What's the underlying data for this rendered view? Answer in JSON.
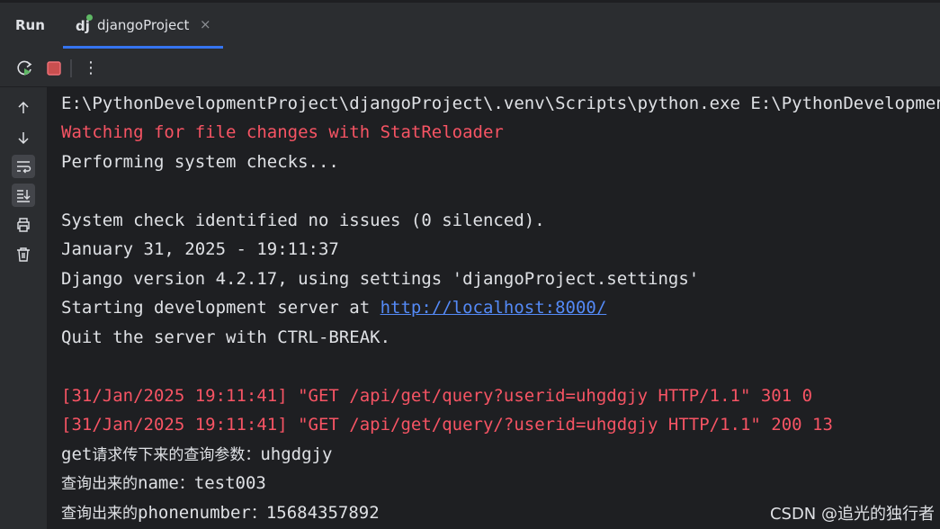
{
  "tabbar": {
    "run_label": "Run",
    "tab_icon_text": "dj",
    "tab_title": "djangoProject",
    "tab_close": "×"
  },
  "toolbar": {
    "icons": [
      "rerun-icon",
      "stop-icon",
      "more-options-icon"
    ],
    "more_glyph": "⋮"
  },
  "sidebar": {
    "icons": [
      "scroll-up-icon",
      "scroll-down-icon",
      "soft-wrap-icon",
      "scroll-to-end-icon",
      "print-icon",
      "clear-all-icon"
    ],
    "active": [
      "soft-wrap-icon",
      "scroll-to-end-icon"
    ]
  },
  "console": {
    "lines": [
      "E:\\PythonDevelopmentProject\\djangoProject\\.venv\\Scripts\\python.exe E:\\PythonDevelopmentPro",
      "Watching for file changes with StatReloader",
      "Performing system checks...",
      "",
      "System check identified no issues (0 silenced).",
      "January 31, 2025 - 19:11:37",
      "Django version 4.2.17, using settings 'djangoProject.settings'",
      "Starting development server at ",
      "Quit the server with CTRL-BREAK.",
      "",
      "[31/Jan/2025 19:11:41] \"GET /api/get/query?userid=uhgdgjy HTTP/1.1\" 301 0",
      "[31/Jan/2025 19:11:41] \"GET /api/get/query/?userid=uhgdgjy HTTP/1.1\" 200 13"
    ],
    "server_url": "http://localhost:8000/",
    "get_prefix": "get",
    "get_cjk": "请求传下来的查询参数：",
    "get_value": "uhgdgjy",
    "name_cjk": "查询出来的",
    "name_key": "name",
    "name_sep": "：",
    "name_value": "test003",
    "phone_cjk": "查询出来的",
    "phone_key": "phonenumber",
    "phone_sep": "：",
    "phone_value": "15684357892",
    "colors": {
      "error_red": "#f75464",
      "link_blue": "#548af7",
      "text": "#dfe1e5",
      "accent": "#3574f0"
    }
  },
  "watermark": "CSDN @追光的独行者"
}
